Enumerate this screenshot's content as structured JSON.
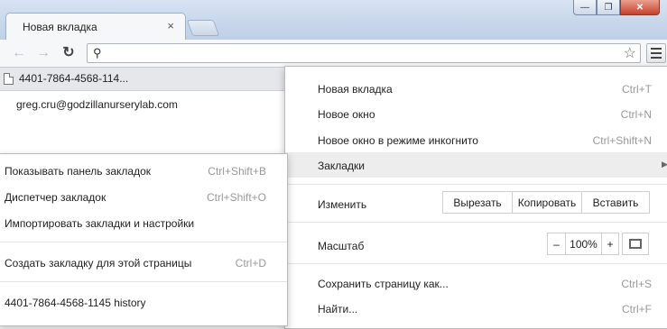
{
  "window": {
    "title_blurred": "",
    "controls": {
      "minimize": "—",
      "maximize": "❐",
      "close": "✕"
    }
  },
  "tab": {
    "title": "Новая вкладка",
    "close": "×"
  },
  "toolbar": {
    "back_icon": "arrow-left-icon",
    "forward_icon": "arrow-right-icon",
    "reload_icon": "reload-icon",
    "omnibox_value": "",
    "search_icon": "search-icon",
    "star_icon": "star-icon",
    "menu_icon": "hamburger-menu-icon"
  },
  "bookmarks_bar": {
    "items": [
      {
        "label": "4401-7864-4568-114..."
      }
    ]
  },
  "page": {
    "email": "greg.cru@godzillanurserylab.com"
  },
  "menu": {
    "new_tab": {
      "label": "Новая вкладка",
      "shortcut": "Ctrl+T"
    },
    "new_window": {
      "label": "Новое окно",
      "shortcut": "Ctrl+N"
    },
    "incognito": {
      "label": "Новое окно в режиме инкогнито",
      "shortcut": "Ctrl+Shift+N"
    },
    "bookmarks": {
      "label": "Закладки",
      "arrow": "▶"
    },
    "edit": {
      "label": "Изменить",
      "cut": "Вырезать",
      "copy": "Копировать",
      "paste": "Вставить"
    },
    "zoom": {
      "label": "Масштаб",
      "minus": "–",
      "value": "100%",
      "plus": "+"
    },
    "save_page": {
      "label": "Сохранить страницу как...",
      "shortcut": "Ctrl+S"
    },
    "find": {
      "label": "Найти...",
      "shortcut": "Ctrl+F"
    }
  },
  "submenu": {
    "show_bar": {
      "label": "Показывать панель закладок",
      "shortcut": "Ctrl+Shift+B"
    },
    "manager": {
      "label": "Диспетчер закладок",
      "shortcut": "Ctrl+Shift+O"
    },
    "import": {
      "label": "Импортировать закладки и настройки"
    },
    "bookmark_page": {
      "label": "Создать закладку для этой страницы",
      "shortcut": "Ctrl+D"
    },
    "history_item": {
      "label": "4401-7864-4568-1145 history"
    }
  },
  "colors": {
    "titlebar": "#c7d6ea",
    "menu_highlight": "#ededed",
    "shortcut_text": "#999999"
  }
}
